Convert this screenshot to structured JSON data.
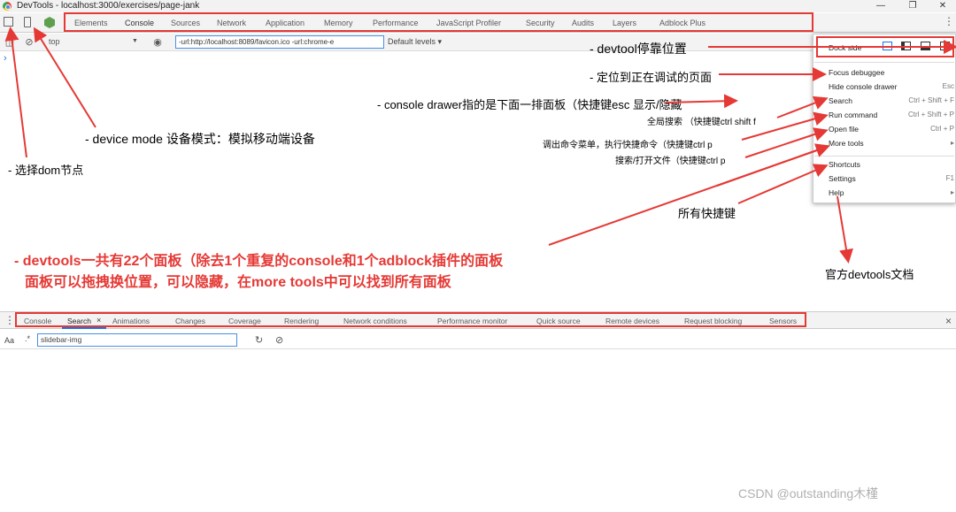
{
  "window": {
    "title": "DevTools - localhost:3000/exercises/page-jank",
    "controls": [
      "minimize-icon",
      "maximize-icon",
      "close-icon"
    ]
  },
  "toolbar": {
    "tabs": [
      "Elements",
      "Console",
      "Sources",
      "Network",
      "Application",
      "Memory",
      "Performance",
      "JavaScript Profiler",
      "Security",
      "Audits",
      "Layers",
      "Adblock Plus"
    ],
    "active_tab": "Console"
  },
  "console_bar": {
    "context": "top",
    "filter_value": "-url:http://localhost:8089/favicon.ico -url:chrome-e",
    "levels": "Default levels ▾",
    "prompt": "›"
  },
  "dock_menu": {
    "dock_side_label": "Dock side",
    "items": [
      {
        "label": "Focus debuggee",
        "shortcut": ""
      },
      {
        "label": "Hide console drawer",
        "shortcut": "Esc"
      },
      {
        "label": "Search",
        "shortcut": "Ctrl + Shift + F"
      },
      {
        "label": "Run command",
        "shortcut": "Ctrl + Shift + P"
      },
      {
        "label": "Open file",
        "shortcut": "Ctrl + P"
      },
      {
        "label": "More tools",
        "shortcut": "▸"
      },
      {
        "label": "Shortcuts",
        "shortcut": ""
      },
      {
        "label": "Settings",
        "shortcut": "F1"
      },
      {
        "label": "Help",
        "shortcut": "▸"
      }
    ]
  },
  "drawer": {
    "tabs": [
      "Console",
      "Search",
      "Animations",
      "Changes",
      "Coverage",
      "Rendering",
      "Network conditions",
      "Performance monitor",
      "Quick source",
      "Remote devices",
      "Request blocking",
      "Sensors"
    ],
    "active_tab": "Search",
    "close_glyph": "×",
    "search_value": "slidebar-img",
    "aa_label": "Aa",
    "regex_label": ".*"
  },
  "annotations": {
    "dock_position": "- devtool停靠位置",
    "focus_page": "- 定位到正在调试的页面",
    "console_drawer": "- console drawer指的是下面一排面板（快捷键esc 显示/隐藏",
    "global_search": "全局搜索 （快捷键ctrl shift f",
    "run_command": "调出命令菜单，执行快捷命令（快捷键ctrl p",
    "open_file": "搜索/打开文件（快捷键ctrl p",
    "device_mode": "- device mode 设备模式：模拟移动端设备",
    "select_dom": "- 选择dom节点",
    "all_shortcuts": "所有快捷键",
    "official_docs": "官方devtools文档",
    "panels_line1": "- devtools一共有22个面板（除去1个重复的console和1个adblock插件的面板",
    "panels_line2": "面板可以拖拽换位置，可以隐藏，在more tools中可以找到所有面板"
  },
  "watermark": "CSDN @outstanding木槿",
  "colors": {
    "annotation_red": "#e53935",
    "active_blue": "#1a73e8",
    "toolbar_bg": "#f3f3f3"
  }
}
